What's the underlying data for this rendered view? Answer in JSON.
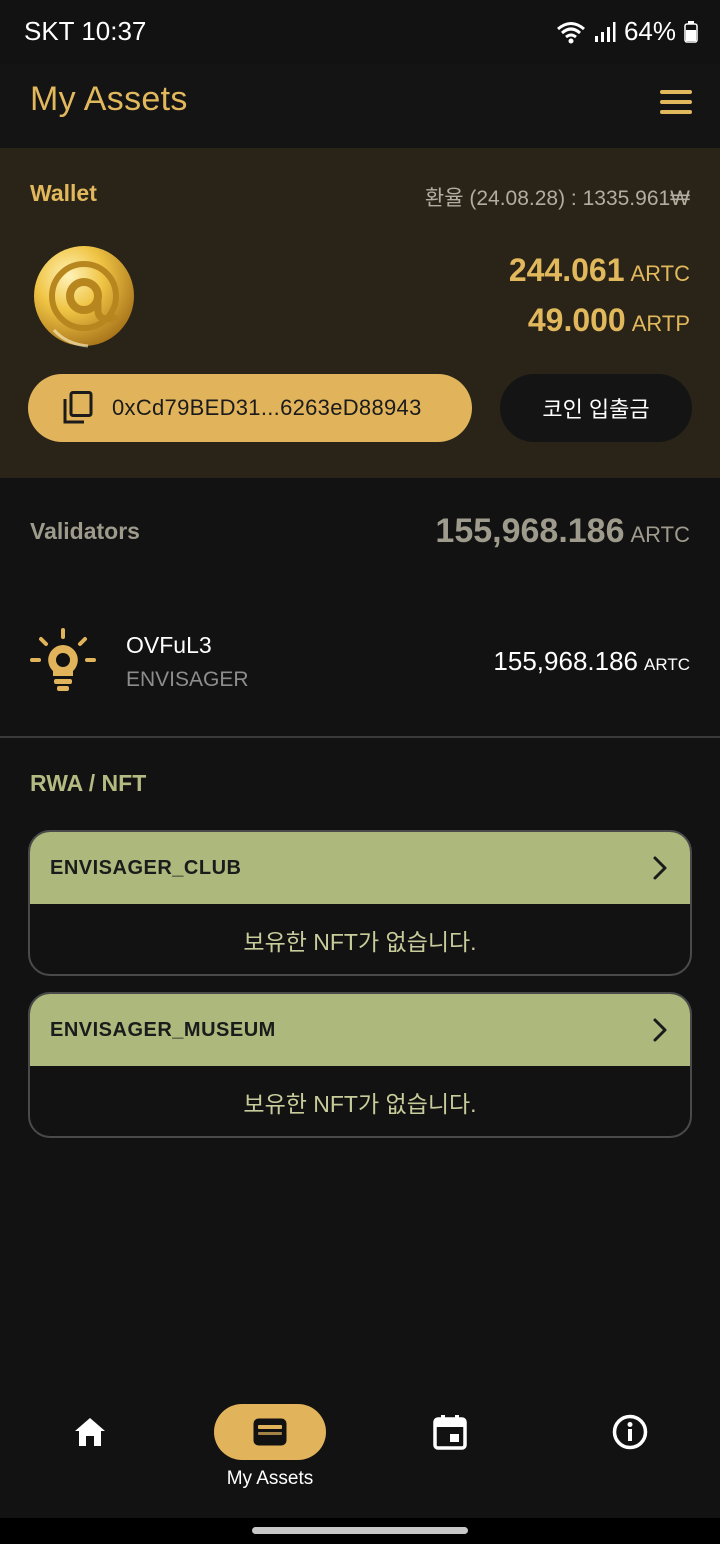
{
  "status_bar": {
    "carrier_time": "SKT 10:37",
    "battery": "64%"
  },
  "header": {
    "title": "My Assets",
    "menu_icon": "hamburger-menu-icon"
  },
  "wallet": {
    "label": "Wallet",
    "exchange_rate": "환율 (24.08.28) : 1335.961₩",
    "balances": [
      {
        "amount": "244.061",
        "unit": "ARTC"
      },
      {
        "amount": "49.000",
        "unit": "ARTP"
      }
    ],
    "address": "0xCd79BED31...6263eD88943",
    "deposit_label": "코인 입출금"
  },
  "validators": {
    "label": "Validators",
    "total_amount": "155,968.186",
    "total_unit": "ARTC",
    "items": [
      {
        "name": "OVFuL3",
        "sub": "ENVISAGER",
        "amount": "155,968.186",
        "unit": "ARTC"
      }
    ]
  },
  "rwa": {
    "label": "RWA / NFT",
    "collections": [
      {
        "title": "ENVISAGER_CLUB",
        "empty_text": "보유한 NFT가 없습니다."
      },
      {
        "title": "ENVISAGER_MUSEUM",
        "empty_text": "보유한 NFT가 없습니다."
      }
    ]
  },
  "bottom_nav": {
    "items": [
      {
        "icon": "home-icon",
        "label": ""
      },
      {
        "icon": "wallet-icon",
        "label": "My Assets",
        "active": true
      },
      {
        "icon": "calendar-icon",
        "label": ""
      },
      {
        "icon": "info-icon",
        "label": ""
      }
    ]
  },
  "colors": {
    "accent": "#e1b35b",
    "background": "#121212",
    "wallet_card": "#2a2418",
    "nft_header": "#adb87d"
  }
}
